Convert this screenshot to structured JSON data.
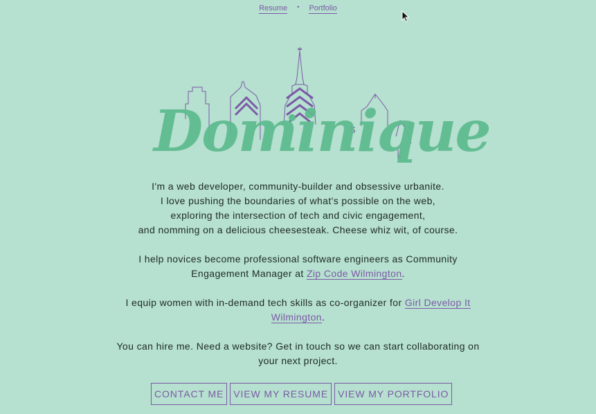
{
  "nav": {
    "links": [
      {
        "label": "Resume"
      },
      {
        "label": "Portfolio"
      }
    ],
    "separator": "•"
  },
  "hero": {
    "name": "Dominique",
    "skyline_sign": "S"
  },
  "bio": {
    "p1": [
      "I'm a web developer, community-builder and obsessive urbanite.",
      "I love pushing the boundaries of what's possible on the web,",
      "exploring the intersection of tech and civic engagement,",
      "and nomming on a delicious cheesesteak. Cheese whiz wit, of course."
    ],
    "p2_pre": "I help novices become professional software engineers as Community Engagement Manager at ",
    "p2_link": "Zip Code Wilmington",
    "p2_post": ".",
    "p3_pre": "I equip women with in-demand tech skills as co-organizer for ",
    "p3_link": "Girl Develop It Wilmington",
    "p3_post": ".",
    "p4": "You can hire me. Need a website? Get in touch so we can start collaborating on your next project."
  },
  "buttons": [
    {
      "label": "CONTACT ME"
    },
    {
      "label": "VIEW MY RESUME"
    },
    {
      "label": "VIEW MY PORTFOLIO"
    }
  ],
  "colors": {
    "background": "#b6e0cf",
    "accent": "#7a5aa6",
    "name": "#5dbb8f",
    "text": "#1d2a24"
  },
  "icons": {
    "cursor": "mouse-pointer-icon",
    "skyline": "philadelphia-skyline-icon"
  }
}
